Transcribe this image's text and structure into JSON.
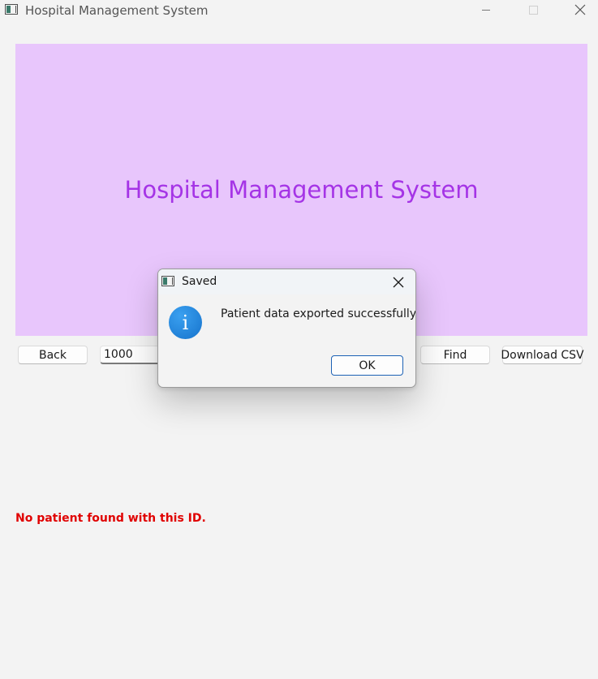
{
  "window": {
    "title": "Hospital Management System",
    "icons": {
      "app": "app-window-icon",
      "minimize": "minimize-icon",
      "maximize": "maximize-icon",
      "close": "close-icon"
    }
  },
  "banner": {
    "title": "Hospital Management System",
    "background": "#e8c6fc",
    "text_color": "#a534e6"
  },
  "controls": {
    "back_label": "Back",
    "patient_id_value": "1000",
    "find_label": "Find",
    "download_label": "Download CSV"
  },
  "status": {
    "error_message": "No patient found with this ID.",
    "error_color": "#e00000"
  },
  "dialog": {
    "title": "Saved",
    "message": "Patient data exported successfully.",
    "ok_label": "OK",
    "icon": "info-icon",
    "icon_glyph": "i"
  }
}
